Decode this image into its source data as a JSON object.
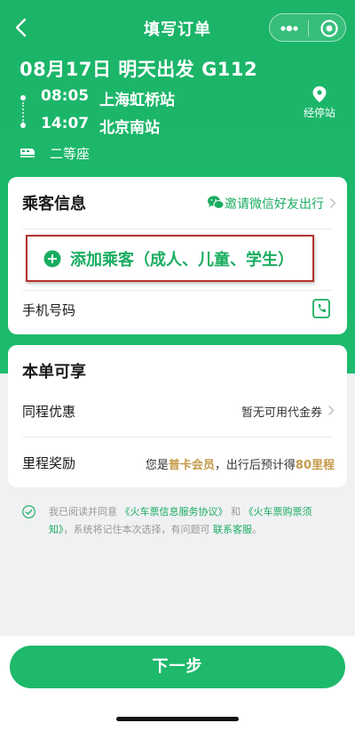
{
  "header": {
    "title": "填写订单",
    "back_icon": "chevron-left-icon",
    "more_icon": "more-dots-icon",
    "close_icon": "target-circle-icon"
  },
  "trip": {
    "title": "08月17日 明天出发 G112",
    "departure": {
      "time": "08:05",
      "station": "上海虹桥站"
    },
    "arrival": {
      "time": "14:07",
      "station": "北京南站"
    },
    "stops_label": "经停站",
    "seat_class": "二等座"
  },
  "passenger": {
    "section_title": "乘客信息",
    "invite_label": "邀请微信好友出行",
    "add_label": "添加乘客（成人、儿童、学生）",
    "phone_label": "手机号码"
  },
  "benefits": {
    "section_title": "本单可享",
    "discount_label": "同程优惠",
    "discount_value": "暂无可用代金券",
    "mileage_label": "里程奖励",
    "mileage_prefix": "您是",
    "member_level": "普卡会员",
    "mileage_mid": "，出行后预计得",
    "mileage_points": "80里程"
  },
  "agreement": {
    "prefix": "我已阅读并同意",
    "link1": "《火车票信息服务协议》",
    "and": "和",
    "link2": "《火车票购票须知》",
    "suffix": "，系统将记住本次选择，有问题可",
    "service_link": "联系客服",
    "end": "。"
  },
  "footer": {
    "next_label": "下一步"
  },
  "colors": {
    "brand_green": "#1bb468",
    "link_green": "#1aad60",
    "gold": "#c49a4a",
    "highlight_red": "#b5322e"
  }
}
